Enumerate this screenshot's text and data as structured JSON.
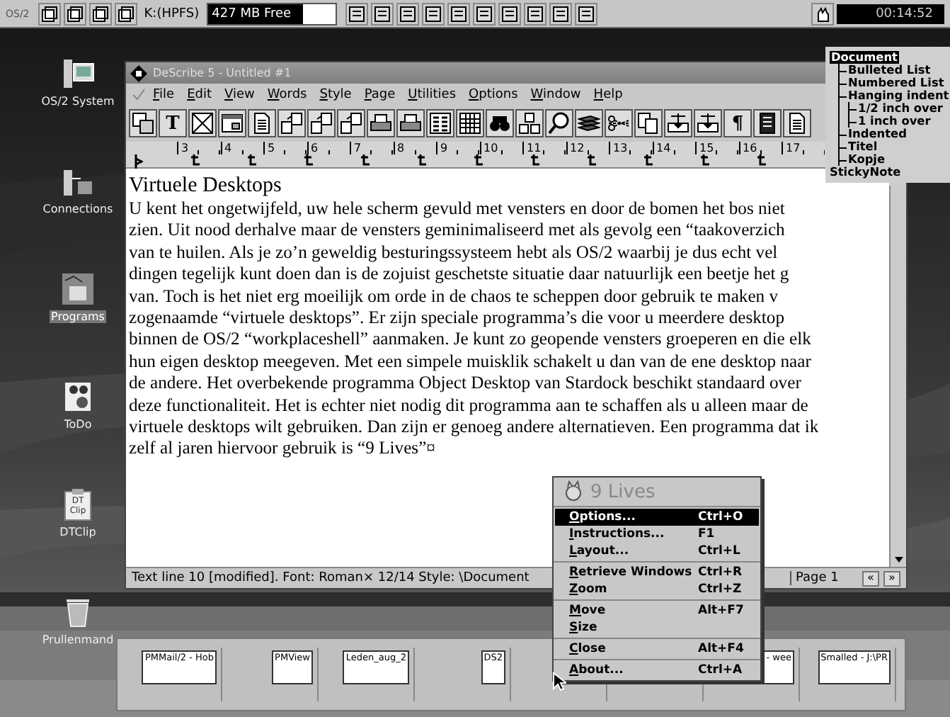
{
  "top_bar": {
    "logo": "OS/2",
    "drive": "K:(HPFS)",
    "free_space": {
      "reading": "427 MB Free",
      "level": 0.75
    },
    "clock": "00:14:52"
  },
  "desktop_icons": [
    {
      "label": "OS/2 System",
      "kind": "system",
      "selected": false
    },
    {
      "label": "Connections",
      "kind": "connections",
      "selected": false
    },
    {
      "label": "Programs",
      "kind": "programs",
      "selected": true
    },
    {
      "label": "ToDo",
      "kind": "todo",
      "selected": false
    },
    {
      "label": "DTClip",
      "kind": "clip",
      "selected": false,
      "icon_text": "DT Clip"
    },
    {
      "label": "Prullenmand",
      "kind": "trash",
      "selected": false
    }
  ],
  "window": {
    "title": "DeScribe 5 - Untitled #1",
    "menu": [
      "File",
      "Edit",
      "View",
      "Words",
      "Style",
      "Page",
      "Utilities",
      "Options",
      "Window",
      "Help"
    ],
    "toolbar": [
      {
        "kind": "frames"
      },
      {
        "kind": "text",
        "label": "T"
      },
      {
        "kind": "cross"
      },
      {
        "kind": "window"
      },
      {
        "kind": "page"
      },
      {
        "kind": "pages"
      },
      {
        "kind": "pages"
      },
      {
        "kind": "pages"
      },
      {
        "kind": "print"
      },
      {
        "kind": "print"
      },
      {
        "kind": "list"
      },
      {
        "kind": "grid"
      },
      {
        "kind": "binoculars"
      },
      {
        "kind": "blocks"
      },
      {
        "kind": "magnifier"
      },
      {
        "kind": "stack"
      },
      {
        "kind": "scissors"
      },
      {
        "kind": "copy"
      },
      {
        "kind": "insert"
      },
      {
        "kind": "insert"
      },
      {
        "kind": "text",
        "label": "¶"
      },
      {
        "kind": "doc-dark"
      },
      {
        "kind": "page"
      }
    ],
    "ruler": [
      "3",
      "4",
      "5",
      "6",
      "7",
      "8",
      "9",
      "10",
      "11",
      "12",
      "13",
      "14",
      "15",
      "16",
      "17"
    ],
    "heading": "Virtuele Desktops",
    "lines": [
      "U kent het ongetwijfeld, uw hele scherm gevuld met vensters en door de bomen het bos niet",
      "zien. Uit nood derhalve maar de vensters geminimaliseerd met als gevolg een “taakoverzich",
      "van te huilen. Als je zo’n geweldig besturingssysteem hebt als OS/2 waarbij je dus echt vel",
      "dingen tegelijk kunt doen dan is de zojuist geschetste situatie daar natuurlijk een beetje het g",
      "van. Toch is het niet erg moeilijk om orde in de chaos te scheppen door gebruik te maken v",
      "zogenaamde “virtuele desktops”. Er zijn speciale programma’s die voor u meerdere desktop",
      "binnen de OS/2  “workplaceshell” aanmaken. Je kunt zo geopende vensters groeperen en die elk",
      "hun eigen desktop meegeven. Met een simpele muisklik schakelt u dan van de ene desktop naar",
      "de andere. Het overbekende programma Object Desktop van Stardock beschikt standaard over",
      "deze functionaliteit. Het is echter niet nodig dit programma aan te schaffen als u alleen maar de",
      "virtuele desktops wilt gebruiken. Dan zijn er genoeg andere alternatieven. Een programma dat ik",
      "zelf al jaren hiervoor gebruik is “9 Lives”¤"
    ],
    "status": "Text line 10 [modified].  Font: Roman× 12/14  Style: \\Document",
    "page": "Page 1",
    "prev": "«",
    "next": "»"
  },
  "styles": [
    {
      "label": "Document",
      "selected": true,
      "children": [
        {
          "label": "Bulleted List",
          "selected": false
        },
        {
          "label": "Numbered List",
          "selected": false
        },
        {
          "label": "Hanging indent",
          "selected": false,
          "children": [
            {
              "label": "1/2 inch over",
              "selected": false
            },
            {
              "label": "1 inch over",
              "selected": false
            }
          ]
        },
        {
          "label": "Indented",
          "selected": false
        },
        {
          "label": "Titel",
          "selected": false
        },
        {
          "label": "Kopje",
          "selected": false
        }
      ]
    },
    {
      "label": "StickyNote",
      "selected": false
    }
  ],
  "context_menu": {
    "title": "9 Lives",
    "sections": [
      [
        {
          "label": "Options...",
          "shortcut": "Ctrl+O",
          "selected": true
        },
        {
          "label": "Instructions...",
          "shortcut": "F1",
          "selected": false
        },
        {
          "label": "Layout...",
          "shortcut": "Ctrl+L",
          "selected": false
        }
      ],
      [
        {
          "label": "Retrieve Windows",
          "shortcut": "Ctrl+R",
          "selected": false
        },
        {
          "label": "Zoom",
          "shortcut": "Ctrl+Z",
          "selected": false
        }
      ],
      [
        {
          "label": "Move",
          "shortcut": "Alt+F7",
          "selected": false
        },
        {
          "label": "Size",
          "selected": false
        }
      ],
      [
        {
          "label": "Close",
          "shortcut": "Alt+F4",
          "selected": false
        }
      ],
      [
        {
          "label": "About...",
          "shortcut": "Ctrl+A",
          "selected": false
        }
      ]
    ]
  },
  "virtual_desktops": [
    {
      "kind": "window",
      "title": "PMMail/2 - Hob"
    },
    {
      "kind": "window",
      "title": "PMView"
    },
    {
      "kind": "window",
      "title": "Leden_aug_2"
    },
    {
      "kind": "window",
      "title": "DS2"
    },
    {
      "kind": "empty"
    },
    {
      "kind": "empty"
    },
    {
      "kind": "window",
      "title": "- wee"
    },
    {
      "kind": "window",
      "title": "Smalled - J:\\PR"
    }
  ]
}
